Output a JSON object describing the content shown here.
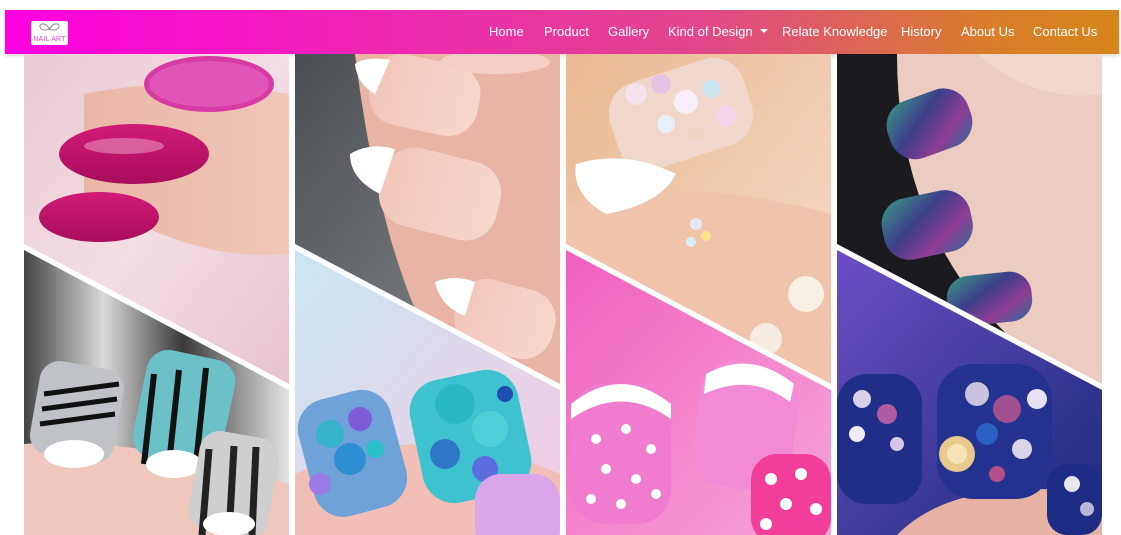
{
  "brand": {
    "logo_text": "NAIL ART"
  },
  "nav": {
    "items": [
      {
        "label": "Home"
      },
      {
        "label": "Product"
      },
      {
        "label": "Gallery"
      },
      {
        "label": "Kind of Design"
      },
      {
        "label": "Relate Knowledge"
      },
      {
        "label": "History"
      },
      {
        "label": "About Us"
      },
      {
        "label": "Contact Us"
      }
    ]
  },
  "colors": {
    "nav_gradient_start": "#ff00e1",
    "nav_gradient_end": "#d6861c",
    "nav_text": "#ffffff"
  },
  "gallery": {
    "images": [
      {
        "name": "magenta-glitter-nails",
        "icon": "nail-photo"
      },
      {
        "name": "silver-black-stripe-nails",
        "icon": "nail-photo"
      },
      {
        "name": "french-tip-nails",
        "icon": "nail-photo"
      },
      {
        "name": "blue-sequin-nails",
        "icon": "nail-photo"
      },
      {
        "name": "rhinestone-white-nails",
        "icon": "nail-photo"
      },
      {
        "name": "pink-polka-dot-nails",
        "icon": "nail-photo"
      },
      {
        "name": "chrome-mirror-nails",
        "icon": "nail-photo"
      },
      {
        "name": "navy-jewel-nails",
        "icon": "nail-photo"
      }
    ]
  }
}
